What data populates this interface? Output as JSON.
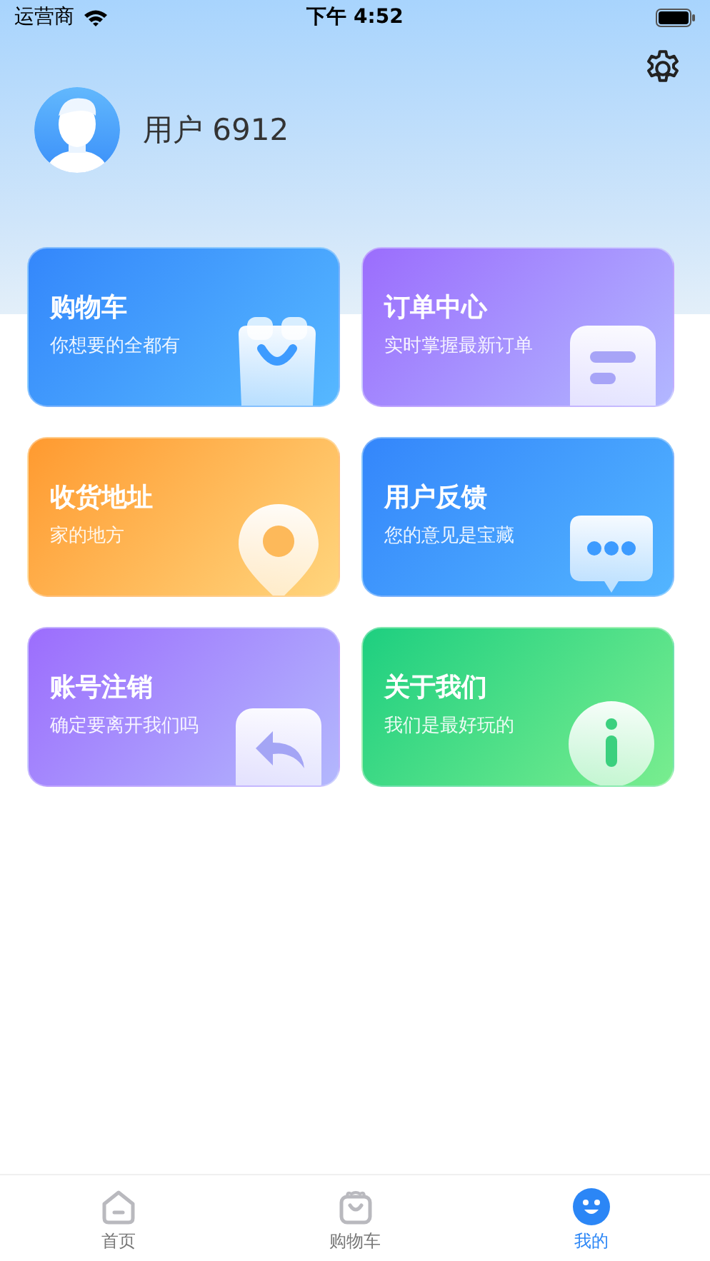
{
  "status_bar": {
    "carrier": "运营商",
    "time": "下午 4:52"
  },
  "profile": {
    "name": "用户 6912"
  },
  "cards": [
    {
      "kind": "cart",
      "title": "购物车",
      "subtitle": "你想要的全都有"
    },
    {
      "kind": "order",
      "title": "订单中心",
      "subtitle": "实时掌握最新订单"
    },
    {
      "kind": "address",
      "title": "收货地址",
      "subtitle": "家的地方"
    },
    {
      "kind": "feedback",
      "title": "用户反馈",
      "subtitle": "您的意见是宝藏"
    },
    {
      "kind": "logout",
      "title": "账号注销",
      "subtitle": "确定要离开我们吗"
    },
    {
      "kind": "about",
      "title": "关于我们",
      "subtitle": "我们是最好玩的"
    }
  ],
  "tab_bar": [
    {
      "kind": "home",
      "label": "首页",
      "selected": false
    },
    {
      "kind": "cart",
      "label": "购物车",
      "selected": false
    },
    {
      "kind": "me",
      "label": "我的",
      "selected": true
    }
  ]
}
